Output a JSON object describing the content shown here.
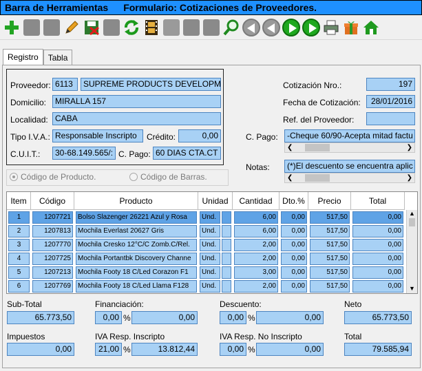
{
  "window": {
    "title": "Barra de Herramientas",
    "subtitle": "Formulario: Cotizaciones de Proveedores."
  },
  "toolbar": {
    "icons": [
      "new-icon",
      "save-icon",
      "save-as-icon",
      "edit-icon",
      "delete-icon",
      "undo-icon",
      "refresh-icon",
      "film-icon",
      "return-icon",
      "grid-icon",
      "grid2-icon",
      "search-icon",
      "first-icon",
      "previous-icon",
      "next-icon",
      "last-icon",
      "print-icon",
      "gift-icon",
      "home-icon"
    ]
  },
  "tabs": [
    {
      "label": "Registro"
    },
    {
      "label": "Tabla"
    }
  ],
  "form": {
    "proveedor_label": "Proveedor:",
    "proveedor_code": "6113",
    "proveedor_name": "SUPREME PRODUCTS DEVELOPM",
    "domicilio_label": "Domicilio:",
    "domicilio": "MIRALLA 157",
    "localidad_label": "Localidad:",
    "localidad": "CABA",
    "tipo_iva_label": "Tipo I.V.A.:",
    "tipo_iva": "Responsable Inscripto",
    "credito_label": "Crédito:",
    "credito": "0,00",
    "cuit_label": "C.U.I.T.:",
    "cuit": "30-68.149.565/:",
    "cpago_label": "C. Pago:",
    "cpago": "60 DIAS CTA.CT",
    "cotizacion_label": "Cotización Nro.:",
    "cotizacion_nro": "197",
    "fecha_label": "Fecha de Cotización:",
    "fecha": "28/01/2016",
    "ref_label": "Ref. del Proveedor:",
    "ref": "",
    "cpago2_label": "C. Pago:",
    "cpago2": "-Cheque 60/90-Acepta mitad factu",
    "notas_label": "Notas:",
    "notas": "(*)El descuento se encuentra aplic",
    "radio_producto": "Código de Producto.",
    "radio_barras": "Código de Barras."
  },
  "table": {
    "headers": [
      "Item",
      "Código",
      "Producto",
      "Unidad",
      "Cantidad",
      "Dto.%",
      "Precio",
      "Total"
    ],
    "rows": [
      {
        "item": "1",
        "codigo": "1207721",
        "producto": "Bolso Slazenger 26221 Azul y Rosa",
        "unidad": "Und.",
        "cantidad": "6,00",
        "dto": "0,00",
        "precio": "517,50",
        "total": "0,00"
      },
      {
        "item": "2",
        "codigo": "1207813",
        "producto": "Mochila Everlast 20627 Gris",
        "unidad": "Und.",
        "cantidad": "6,00",
        "dto": "0,00",
        "precio": "517,50",
        "total": "0,00"
      },
      {
        "item": "3",
        "codigo": "1207770",
        "producto": "Mochila Cresko 12°C/C Zomb.C/Rel.",
        "unidad": "Und.",
        "cantidad": "2,00",
        "dto": "0,00",
        "precio": "517,50",
        "total": "0,00"
      },
      {
        "item": "4",
        "codigo": "1207725",
        "producto": "Mochila Portantbk Discovery Channe",
        "unidad": "Und.",
        "cantidad": "2,00",
        "dto": "0,00",
        "precio": "517,50",
        "total": "0,00"
      },
      {
        "item": "5",
        "codigo": "1207213",
        "producto": "Mochila Footy 18 C/Led Corazon F1",
        "unidad": "Und.",
        "cantidad": "3,00",
        "dto": "0,00",
        "precio": "517,50",
        "total": "0,00"
      },
      {
        "item": "6",
        "codigo": "1207769",
        "producto": "Mochila Footy 18 C/Led Llama F128",
        "unidad": "Und.",
        "cantidad": "2,00",
        "dto": "0,00",
        "precio": "517,50",
        "total": "0,00"
      }
    ]
  },
  "totals": {
    "subtotal_label": "Sub-Total",
    "subtotal": "65.773,50",
    "financiacion_label": "Financiación:",
    "financiacion_pct": "0,00",
    "financiacion": "0,00",
    "descuento_label": "Descuento:",
    "descuento_pct": "0,00",
    "descuento": "0,00",
    "neto_label": "Neto",
    "neto": "65.773,50",
    "impuestos_label": "Impuestos",
    "impuestos": "0,00",
    "iva_ri_label": "IVA Resp. Inscripto",
    "iva_ri_pct": "21,00",
    "iva_ri": "13.812,44",
    "iva_rni_label": "IVA Resp. No Inscripto",
    "iva_rni_pct": "0,00",
    "iva_rni": "0,00",
    "total_label": "Total",
    "total": "79.585,94",
    "pct_symbol": "%"
  }
}
